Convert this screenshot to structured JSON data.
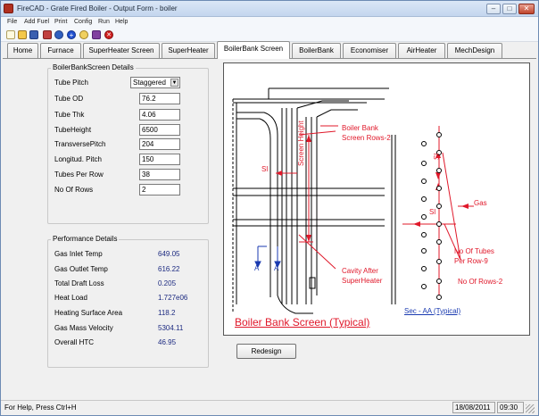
{
  "window": {
    "title": "FireCAD - Grate Fired Boiler - Output Form - boiler",
    "min_label": "–",
    "max_label": "□",
    "close_label": "✕"
  },
  "menu": [
    "File",
    "Add Fuel",
    "Print",
    "Config",
    "Run",
    "Help"
  ],
  "toolbar": {
    "icons": [
      "new-icon",
      "open-icon",
      "save-icon",
      "fuel-icon",
      "run-icon",
      "add-icon",
      "settings-icon",
      "book-icon",
      "stop-icon"
    ]
  },
  "tabs": [
    "Home",
    "Furnace",
    "SuperHeater Screen",
    "SuperHeater",
    "BoilerBank Screen",
    "BoilerBank",
    "Economiser",
    "AirHeater",
    "MechDesign"
  ],
  "active_tab": "BoilerBank Screen",
  "details": {
    "title": "BoilerBankScreen Details",
    "tube_pitch_label": "Tube Pitch",
    "tube_pitch_value": "Staggered",
    "tube_od_label": "Tube OD",
    "tube_od_value": "76.2",
    "tube_thk_label": "Tube Thk",
    "tube_thk_value": "4.06",
    "tube_height_label": "TubeHeight",
    "tube_height_value": "6500",
    "transverse_pitch_label": "TransversePitch",
    "transverse_pitch_value": "204",
    "longitud_pitch_label": "Longitud. Pitch",
    "longitud_pitch_value": "150",
    "tubes_per_row_label": "Tubes Per Row",
    "tubes_per_row_value": "38",
    "no_of_rows_label": "No Of Rows",
    "no_of_rows_value": "2"
  },
  "performance": {
    "title": "Performance Details",
    "rows": [
      {
        "label": "Gas Inlet Temp",
        "value": "649.05"
      },
      {
        "label": "Gas Outlet Temp",
        "value": "616.22"
      },
      {
        "label": "Total Draft Loss",
        "value": "0.205"
      },
      {
        "label": "Heat Load",
        "value": "1.727e06"
      },
      {
        "label": "Heating Surface Area",
        "value": "118.2"
      },
      {
        "label": "Gas Mass Velocity",
        "value": "5304.11"
      },
      {
        "label": "Overall HTC",
        "value": "46.95"
      }
    ]
  },
  "drawing": {
    "caption": "Boiler Bank Screen (Typical)",
    "section_caption": "Sec - AA (Typical)",
    "boiler_bank_label_1": "Boiler Bank",
    "boiler_bank_label_2": "Screen Rows-2",
    "sl_label": "Sl",
    "screen_height_label": "Screen Height",
    "cavity_label_1": "Cavity After",
    "cavity_label_2": "SuperHeater",
    "a_label": "A",
    "gas_label": "Gas",
    "tubes_label_1": "No Of Tubes",
    "tubes_label_2": "Per Row-9",
    "rows_label": "No Of Rows-2",
    "accent_color": "#e0182a"
  },
  "redesign_label": "Redesign",
  "status": {
    "help": "For Help, Press Ctrl+H",
    "date": "18/08/2011",
    "time": "09:30"
  }
}
